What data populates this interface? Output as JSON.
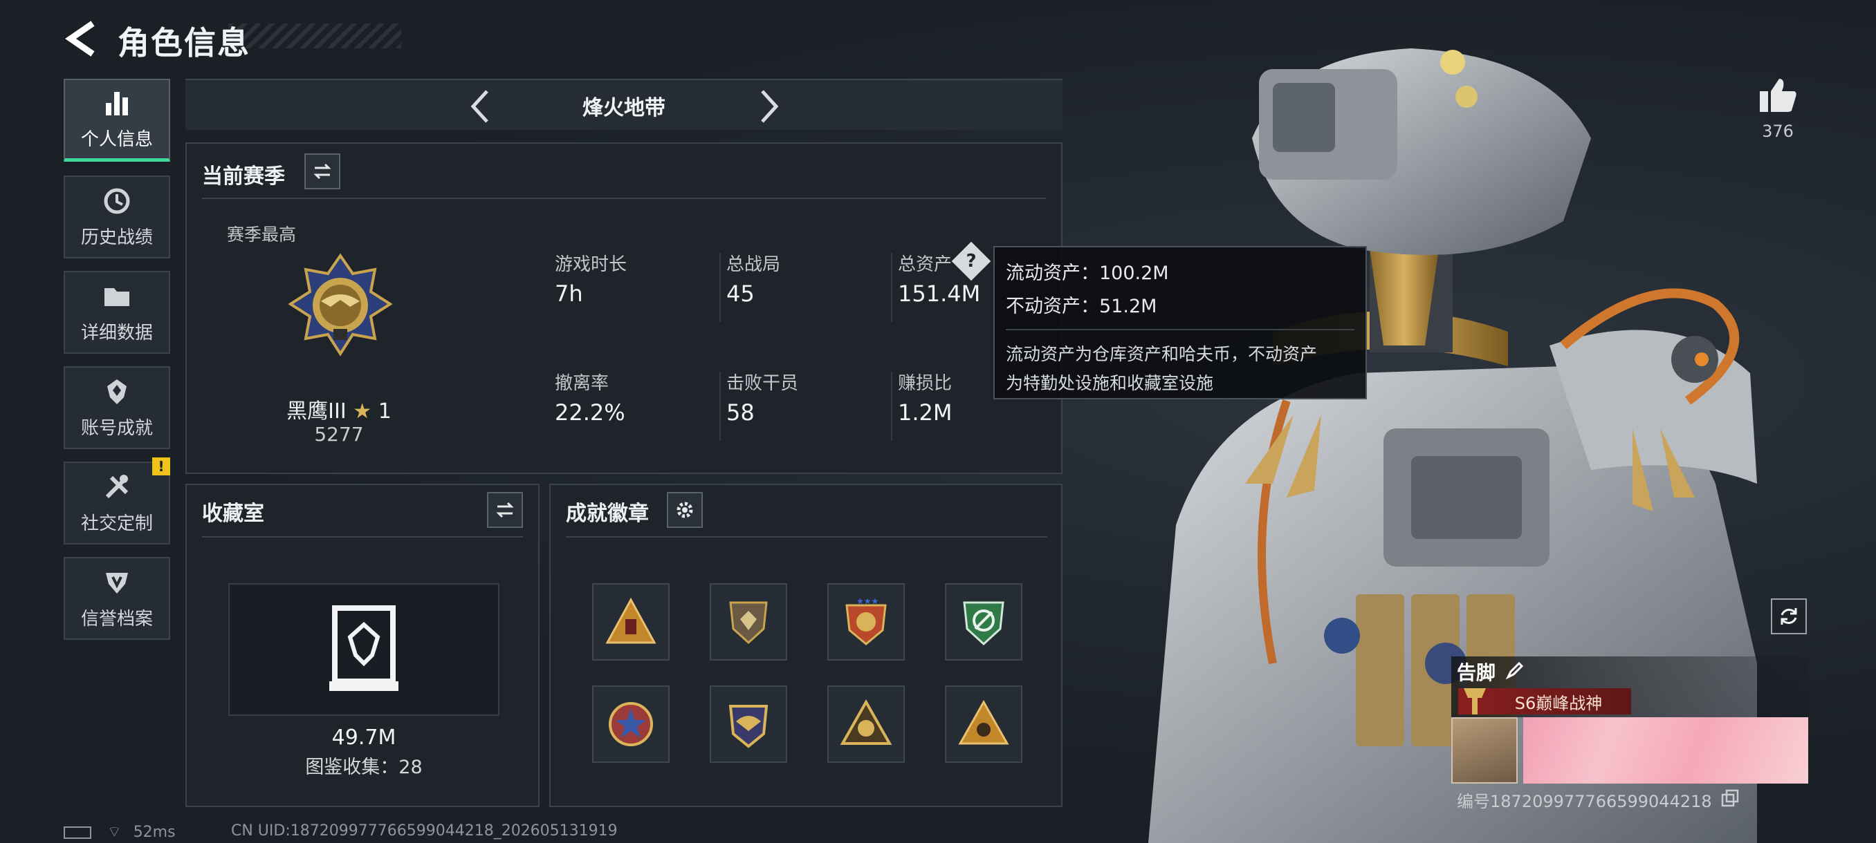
{
  "header": {
    "title": "角色信息"
  },
  "sidebar": {
    "items": [
      {
        "label": "个人信息",
        "icon": "bar-chart-icon",
        "active": true
      },
      {
        "label": "历史战绩",
        "icon": "history-icon"
      },
      {
        "label": "详细数据",
        "icon": "folder-icon"
      },
      {
        "label": "账号成就",
        "icon": "achievement-icon"
      },
      {
        "label": "社交定制",
        "icon": "tools-icon",
        "badge": "!"
      },
      {
        "label": "信誉档案",
        "icon": "shield-badge-icon"
      }
    ]
  },
  "mode": {
    "name": "烽火地带"
  },
  "season": {
    "title": "当前赛季",
    "best_label": "赛季最高",
    "rank_name": "黑鹰III",
    "rank_stars": "1",
    "rank_score": "5277",
    "stats": [
      {
        "label": "游戏时长",
        "value": "7h"
      },
      {
        "label": "总战局",
        "value": "45"
      },
      {
        "label": "总资产",
        "value": "151.4M"
      },
      {
        "label": "撤离率",
        "value": "22.2%"
      },
      {
        "label": "击败干员",
        "value": "58"
      },
      {
        "label": "赚损比",
        "value": "1.2M"
      }
    ]
  },
  "tooltip": {
    "liquid": "流动资产：100.2M",
    "fixed": "不动资产：51.2M",
    "desc_line1": "流动资产为仓库资产和哈夫币，不动资产",
    "desc_line2": "为特勤处设施和收藏室设施"
  },
  "collection": {
    "title": "收藏室",
    "value": "49.7M",
    "count_text": "图鉴收集：28"
  },
  "achievements": {
    "title": "成就徽章",
    "badges": [
      "badge-1",
      "badge-2",
      "badge-3",
      "badge-4",
      "badge-5",
      "badge-6",
      "badge-7",
      "badge-8"
    ]
  },
  "profile": {
    "like_count": "376",
    "player_name": "告脚",
    "player_title": "S6巅峰战神",
    "player_id": "编号18720997776659904421​8"
  },
  "status": {
    "ping": "52ms",
    "uid": "CN UID:187209977766599044218_202605131919"
  }
}
